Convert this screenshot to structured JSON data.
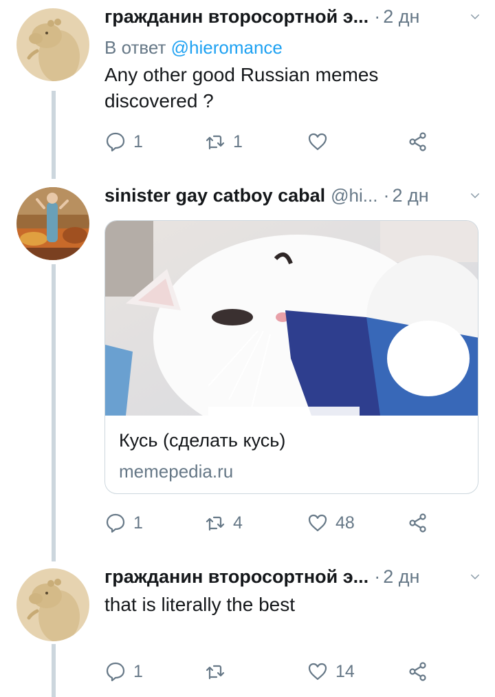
{
  "tweets": [
    {
      "name": "гражданин второсортной э...",
      "time": "2 дн",
      "reply_prefix": "В ответ",
      "reply_mention": "@hieromance",
      "text_line1": "Any other good Russian memes",
      "text_line2": "discovered  ?",
      "replies": "1",
      "retweets": "1",
      "likes": ""
    },
    {
      "name": "sinister gay catboy cabal",
      "handle": "@hi...",
      "time": "2 дн",
      "card": {
        "title": "Кусь (сделать кусь)",
        "domain": "memepedia.ru"
      },
      "replies": "1",
      "retweets": "4",
      "likes": "48"
    },
    {
      "name": "гражданин второсортной э...",
      "time": "2 дн",
      "text_line1": "that is literally the best",
      "replies": "1",
      "retweets": "",
      "likes": "14"
    }
  ],
  "separator_dot": "·",
  "icons": {
    "reply": "reply-icon",
    "retweet": "retweet-icon",
    "like": "heart-icon",
    "share": "share-icon",
    "menu": "chevron-down-icon"
  },
  "colors": {
    "text": "#14171a",
    "secondary": "#657786",
    "link": "#1da1f2",
    "thread_line": "#ccd6dd"
  }
}
